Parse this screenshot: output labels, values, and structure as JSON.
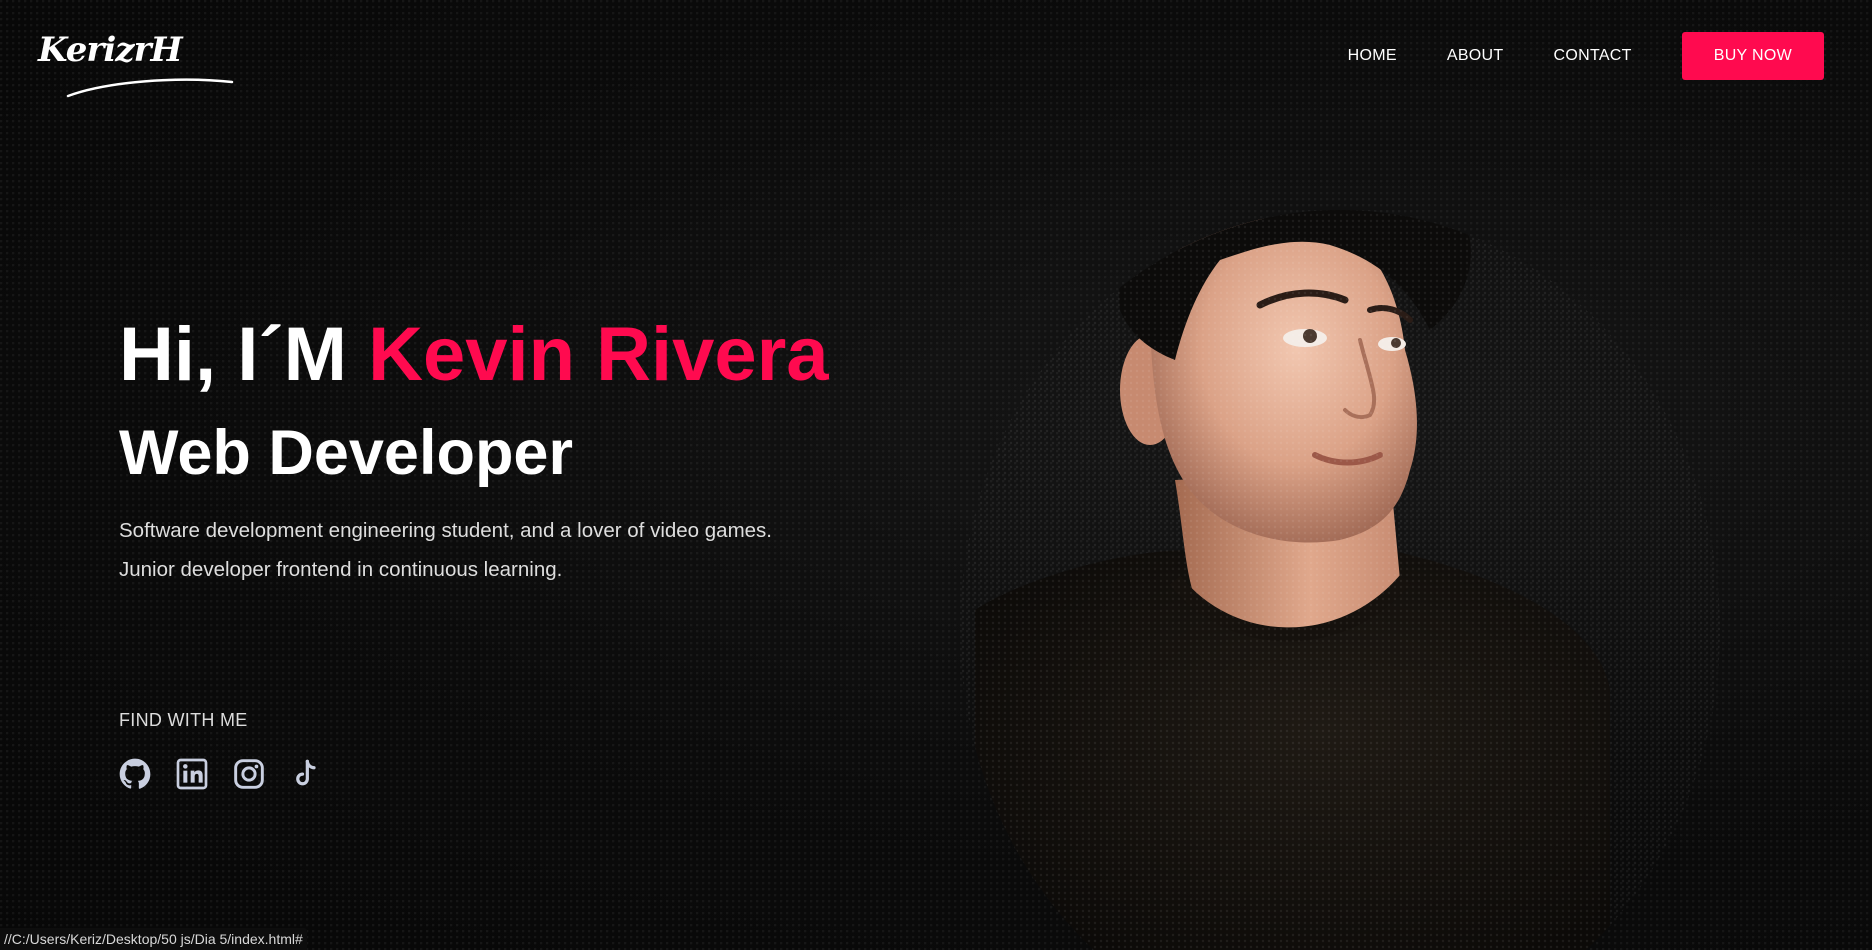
{
  "logo": {
    "text": "KerizrH"
  },
  "nav": {
    "items": [
      "HOME",
      "ABOUT",
      "CONTACT"
    ],
    "buy_label": "BUY NOW"
  },
  "hero": {
    "greeting_prefix": "Hi, I´M ",
    "greeting_name": "Kevin Rivera",
    "role": "Web Developer",
    "line1": "Software development engineering student, and a lover of video games.",
    "line2": "Junior developer frontend in continuous learning."
  },
  "find": {
    "label": "FIND WITH ME",
    "icons": [
      "github-icon",
      "linkedin-icon",
      "instagram-icon",
      "tiktok-icon"
    ]
  },
  "status_bar": {
    "url": "//C:/Users/Keriz/Desktop/50 js/Dia 5/index.html#"
  },
  "colors": {
    "accent": "#ff0a4f",
    "background": "#0b0b0b",
    "text": "#ffffff",
    "icon": "#c9cfe0"
  }
}
